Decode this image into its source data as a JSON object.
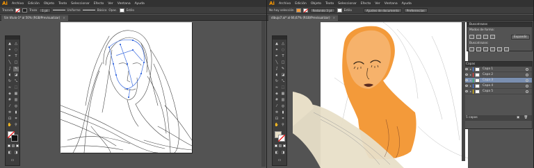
{
  "left_window": {
    "app_logo": "Ai",
    "menu": [
      "Archivo",
      "Edición",
      "Objeto",
      "Texto",
      "Seleccionar",
      "Efecto",
      "Ver",
      "Ventana",
      "Ayuda"
    ],
    "control_bar": {
      "selection_label": "Trazado",
      "opacity_label": "Trazo",
      "weight_value": "1 pt",
      "brush_label": "Uniforme",
      "profile_label": "Básico",
      "opacity2_label": "Opac.",
      "style_label": "Estilo"
    },
    "document_tab": "Sin título-1* al 50% (RGB/Previsualizar)",
    "tab_close": "×"
  },
  "right_window": {
    "app_logo": "Ai",
    "menu": [
      "Archivo",
      "Edición",
      "Objeto",
      "Texto",
      "Seleccionar",
      "Efecto",
      "Ver",
      "Ventana",
      "Ayuda"
    ],
    "control_bar": {
      "selection_label": "No hay selección",
      "weight_value": "Redondo 3 pt",
      "style_label": "Estilo",
      "prefs_button": "Ajustes de documento",
      "prefs2_button": "Preferencias"
    },
    "document_tab": "dibujo7.ai* al 66,67% (RGB/Previsualizar)",
    "tab_close": "×",
    "pathfinder_panel": {
      "title": "Buscatrazos",
      "shape_modes_label": "Modos de forma:",
      "expand_button": "Expandir",
      "pathfinders_label": "Buscatrazos:"
    },
    "layers_panel": {
      "title": "Capas",
      "layers": [
        {
          "name": "Capa 1",
          "color": "#4f8cff",
          "selected": false
        },
        {
          "name": "Capa 2",
          "color": "#ff3b3b",
          "selected": false
        },
        {
          "name": "Capa 3",
          "color": "#27c24c",
          "selected": true
        },
        {
          "name": "Capa 4",
          "color": "#3f7cff",
          "selected": false
        },
        {
          "name": "Capa 5",
          "color": "#ffcc00",
          "selected": false
        }
      ],
      "footer_label": "5 capas"
    }
  },
  "colors": {
    "accent_orange": "#f39a3a",
    "skin_light": "#f6b26b",
    "paper_beige": "#e8dfc8",
    "ui_dark": "#323232",
    "ui_mid": "#535353",
    "selection_blue": "#3f6fe0"
  }
}
